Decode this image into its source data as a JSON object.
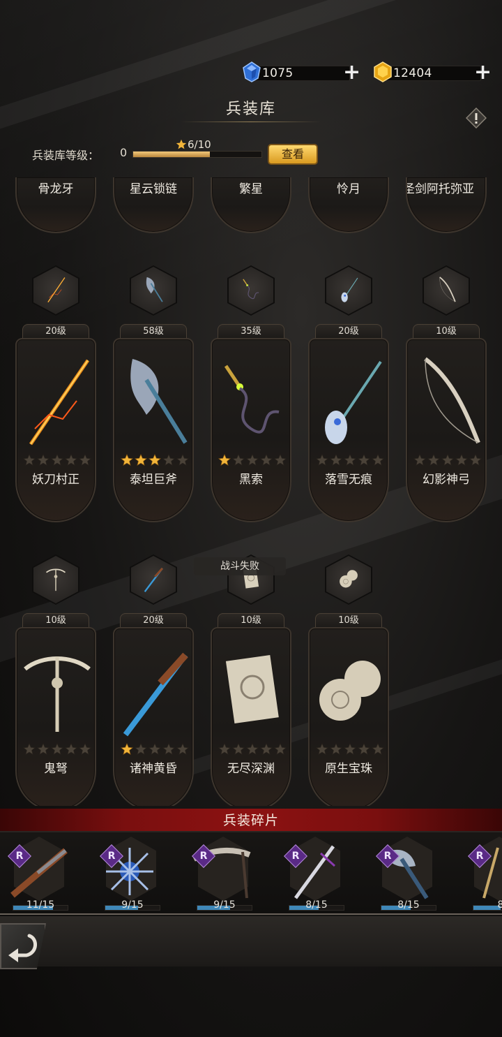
{
  "currencies": [
    {
      "name": "diamond",
      "value": "1075",
      "icon": "blue-gem-icon",
      "color": "#3d7fe0"
    },
    {
      "name": "gold",
      "value": "12404",
      "icon": "gold-gem-icon",
      "color": "#f2b21e"
    }
  ],
  "title": "兵装库",
  "armory_level": {
    "label": "兵装库等级：",
    "value": "0",
    "progress_text": "6/10",
    "progress": 0.6,
    "view_button": "查看"
  },
  "top_row_names": [
    "骨龙牙",
    "星云锁链",
    "繁星",
    "怜月",
    "圣剑阿托弥亚"
  ],
  "weapons_row1": [
    {
      "name": "妖刀村正",
      "level": "20级",
      "stars": 0,
      "icon": "katana-icon"
    },
    {
      "name": "泰坦巨斧",
      "level": "58级",
      "stars": 3,
      "icon": "battle-axe-icon"
    },
    {
      "name": "黑索",
      "level": "35级",
      "stars": 1,
      "icon": "chain-whip-icon"
    },
    {
      "name": "落雪无痕",
      "level": "20级",
      "stars": 0,
      "icon": "spear-icon"
    },
    {
      "name": "幻影神弓",
      "level": "10级",
      "stars": 0,
      "icon": "bow-icon"
    }
  ],
  "weapons_row2": [
    {
      "name": "鬼弩",
      "level": "10级",
      "stars": 0,
      "icon": "crossbow-icon"
    },
    {
      "name": "诸神黄昏",
      "level": "20级",
      "stars": 1,
      "icon": "rifle-icon"
    },
    {
      "name": "无尽深渊",
      "level": "10级",
      "stars": 0,
      "icon": "tome-icon"
    },
    {
      "name": "原生宝珠",
      "level": "10级",
      "stars": 0,
      "icon": "orb-icon"
    }
  ],
  "toast": "战斗失败",
  "fragments": {
    "title": "兵装碎片",
    "rarity": "R",
    "items": [
      {
        "count": "11/15",
        "progress": 0.733,
        "icon": "flintlock-pistol-icon"
      },
      {
        "count": "9/15",
        "progress": 0.6,
        "icon": "spiked-star-icon"
      },
      {
        "count": "9/15",
        "progress": 0.6,
        "icon": "scythe-icon"
      },
      {
        "count": "8/15",
        "progress": 0.533,
        "icon": "sword-icon"
      },
      {
        "count": "8/15",
        "progress": 0.533,
        "icon": "axe-icon"
      },
      {
        "count": "8",
        "progress": 0.5,
        "icon": "staff-icon"
      }
    ]
  },
  "back_icon": "back-arrow-icon"
}
